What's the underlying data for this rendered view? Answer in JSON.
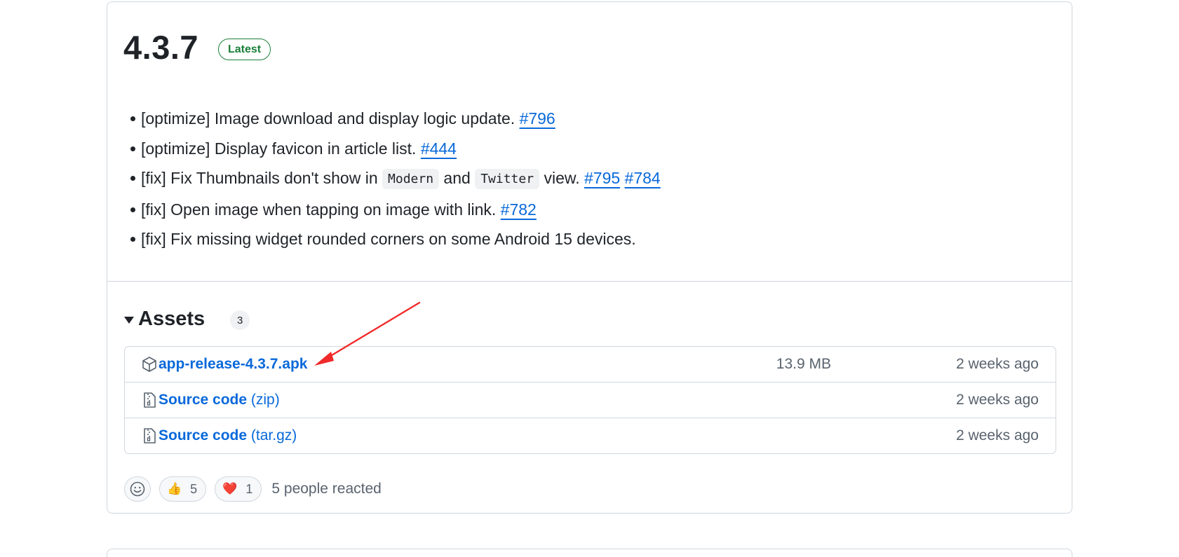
{
  "release": {
    "version": "4.3.7",
    "badge": "Latest",
    "notes": [
      {
        "pre": "[optimize] Image download and display logic update. ",
        "links": [
          "#796"
        ]
      },
      {
        "pre": "[optimize] Display favicon in article list. ",
        "links": [
          "#444"
        ]
      },
      {
        "pre": "[fix] Fix Thumbnails don't show in ",
        "code1": "Modern",
        "mid": " and ",
        "code2": "Twitter",
        "post": " view. ",
        "links": [
          "#795",
          "#784"
        ]
      },
      {
        "pre": "[fix] Open image when tapping on image with link. ",
        "links": [
          "#782"
        ]
      },
      {
        "pre": "[fix] Fix missing widget rounded corners on some Android 15 devices."
      }
    ]
  },
  "assets": {
    "title": "Assets",
    "count": "3",
    "items": [
      {
        "icon": "package-icon",
        "name": "app-release-4.3.7.apk",
        "suffix": "",
        "size": "13.9 MB",
        "date": "2 weeks ago"
      },
      {
        "icon": "file-zip-icon",
        "name": "Source code",
        "suffix": "(zip)",
        "size": "",
        "date": "2 weeks ago"
      },
      {
        "icon": "file-zip-icon",
        "name": "Source code",
        "suffix": "(tar.gz)",
        "size": "",
        "date": "2 weeks ago"
      }
    ]
  },
  "reactions": {
    "add_icon": "smiley-icon",
    "items": [
      {
        "emoji": "👍",
        "name": "thumbs-up-icon",
        "count": "5"
      },
      {
        "emoji": "❤️",
        "name": "heart-icon",
        "count": "1"
      }
    ],
    "summary": "5 people reacted"
  },
  "annotation": {
    "arrow_color": "#f02a2a"
  },
  "colors": {
    "link": "#0969da",
    "latest": "#1a7f37",
    "border": "#d0d7de"
  }
}
